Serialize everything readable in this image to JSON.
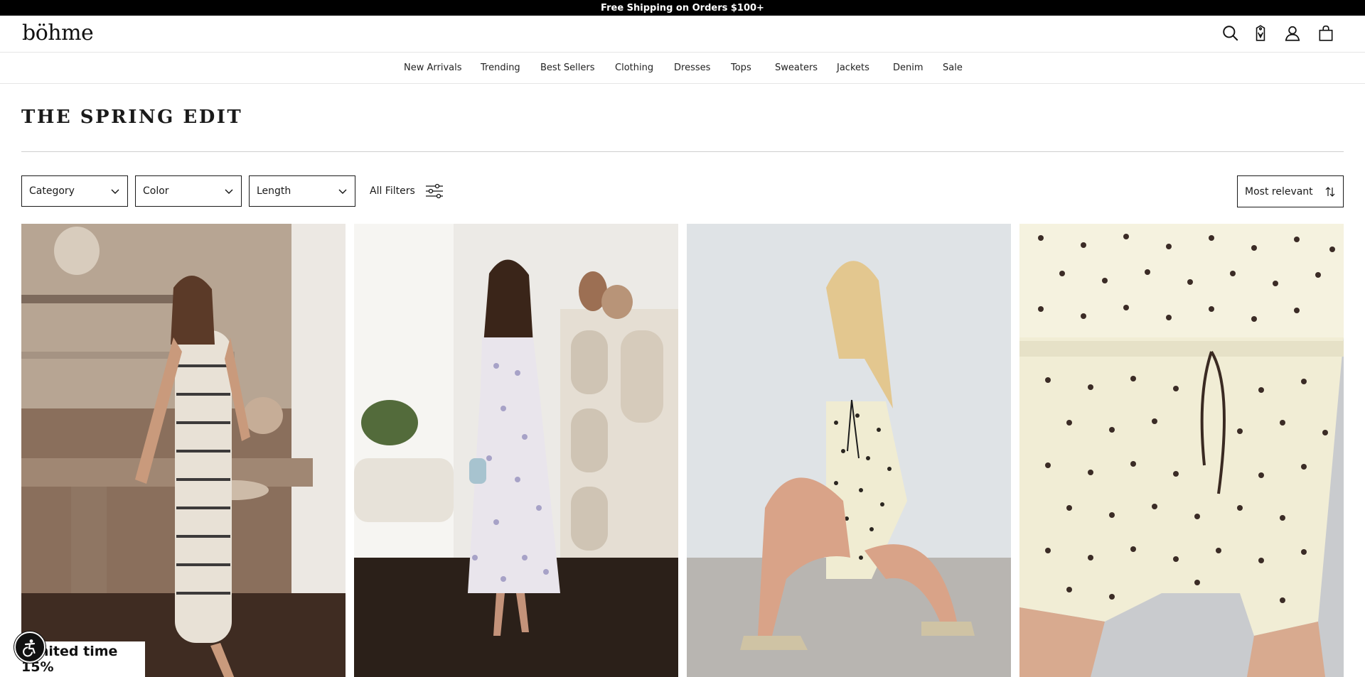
{
  "announcement": "Free Shipping on Orders $100+",
  "header": {
    "logo": "böhme",
    "icons": [
      "search-icon",
      "gift-tag-icon",
      "account-icon",
      "cart-icon"
    ]
  },
  "nav": [
    "New Arrivals",
    "Trending",
    "Best Sellers",
    "Clothing",
    "Dresses",
    "Tops",
    "Sweaters",
    "Jackets",
    "Denim",
    "Sale"
  ],
  "page": {
    "title": "The Spring Edit"
  },
  "filters": {
    "category": "Category",
    "color": "Color",
    "length": "Length",
    "all_filters": "All Filters"
  },
  "sort": {
    "selected": "Most relevant"
  },
  "products": [
    {
      "image": "woman in striped sleeveless knit midi dress leaning on wooden table"
    },
    {
      "image": "woman in floral ruffle-sleeve midi dress walking in living room"
    },
    {
      "image": "woman in polka dot halter top and shorts set crouching"
    },
    {
      "image": "close-up of polka dot drawstring shorts and top"
    }
  ],
  "promo": {
    "text": "Limited time 15%"
  },
  "colors": {
    "announcement_bg": "#000000",
    "border": "#1a1a1a",
    "rule": "#cfcfcf"
  }
}
